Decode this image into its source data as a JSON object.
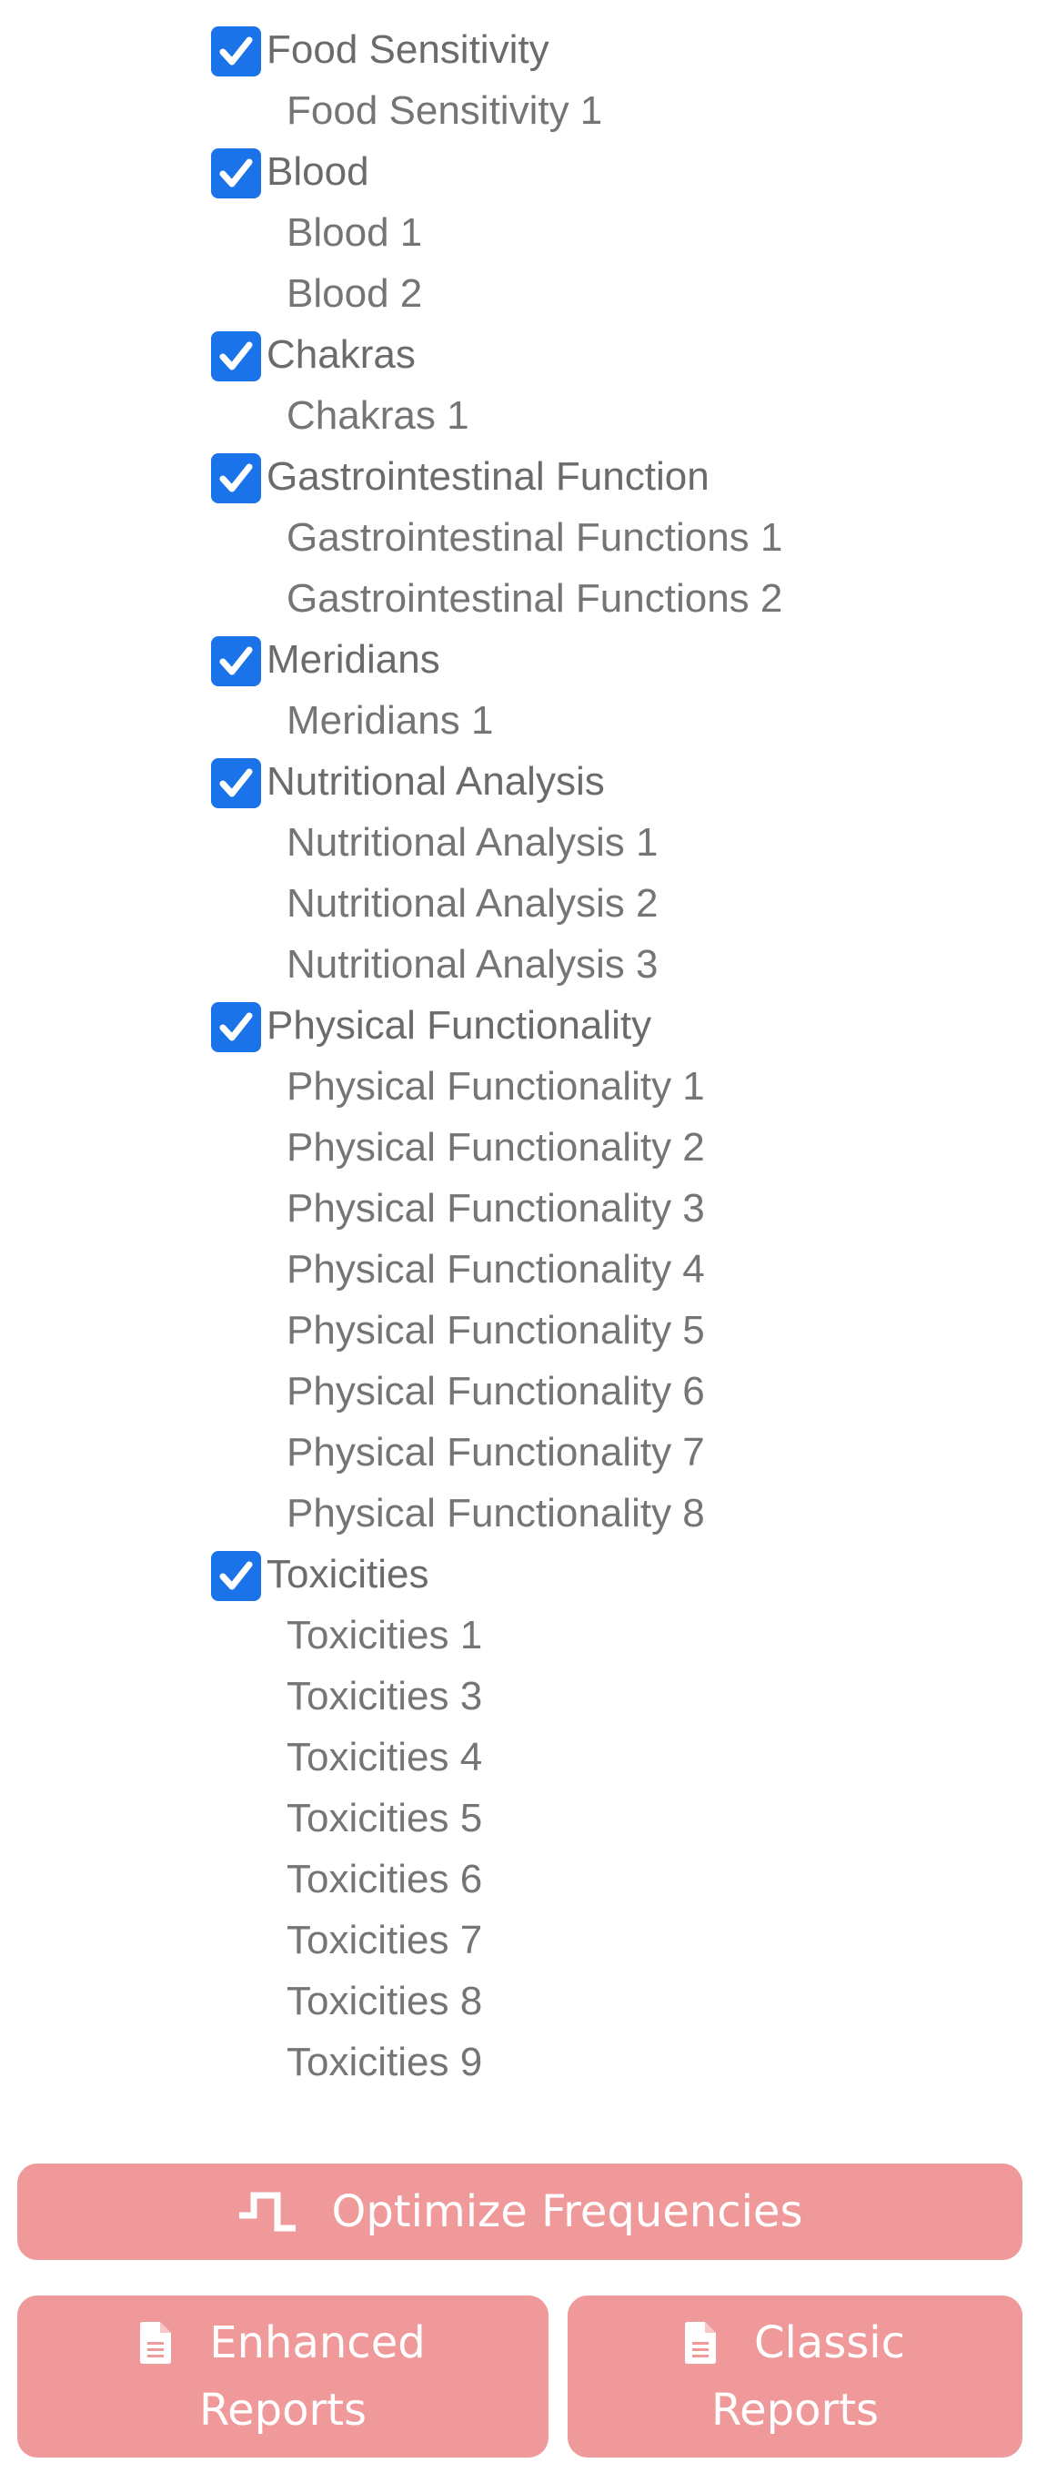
{
  "categories": [
    {
      "label": "Food Sensitivity",
      "checked": true,
      "items": [
        "Food Sensitivity 1"
      ]
    },
    {
      "label": "Blood",
      "checked": true,
      "items": [
        "Blood 1",
        "Blood 2"
      ]
    },
    {
      "label": "Chakras",
      "checked": true,
      "items": [
        "Chakras 1"
      ]
    },
    {
      "label": "Gastrointestinal Function",
      "checked": true,
      "items": [
        "Gastrointestinal Functions 1",
        "Gastrointestinal Functions 2"
      ]
    },
    {
      "label": "Meridians",
      "checked": true,
      "items": [
        "Meridians 1"
      ]
    },
    {
      "label": "Nutritional Analysis",
      "checked": true,
      "items": [
        "Nutritional Analysis 1",
        "Nutritional Analysis 2",
        "Nutritional Analysis 3"
      ]
    },
    {
      "label": "Physical Functionality",
      "checked": true,
      "items": [
        "Physical Functionality 1",
        "Physical Functionality 2",
        "Physical Functionality 3",
        "Physical Functionality 4",
        "Physical Functionality 5",
        "Physical Functionality 6",
        "Physical Functionality 7",
        "Physical Functionality 8"
      ]
    },
    {
      "label": "Toxicities",
      "checked": true,
      "items": [
        "Toxicities 1",
        "Toxicities 3",
        "Toxicities 4",
        "Toxicities 5",
        "Toxicities 6",
        "Toxicities 7",
        "Toxicities 8",
        "Toxicities 9"
      ]
    }
  ],
  "buttons": {
    "optimize": {
      "label": "Optimize Frequencies",
      "icon": "pulse-icon"
    },
    "enhanced": {
      "line1": "Enhanced",
      "line2": "Reports",
      "icon": "document-icon"
    },
    "classic": {
      "line1": "Classic",
      "line2": "Reports",
      "icon": "document-icon"
    }
  },
  "colors": {
    "checkbox": "#1a73e8",
    "button": "#f0999b",
    "text": "#757575"
  }
}
